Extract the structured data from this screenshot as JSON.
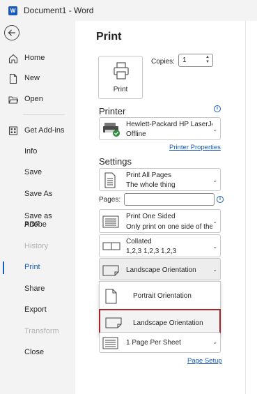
{
  "window": {
    "app_icon": "word-icon",
    "app_letter": "W",
    "title": "Document1  -  Word"
  },
  "nav": {
    "items": [
      {
        "label": "Home",
        "icon": "home-icon"
      },
      {
        "label": "New",
        "icon": "new-document-icon"
      },
      {
        "label": "Open",
        "icon": "open-folder-icon"
      },
      {
        "label": "Get Add-ins",
        "icon": "add-ins-icon"
      },
      {
        "label": "Info"
      },
      {
        "label": "Save"
      },
      {
        "label": "Save As"
      },
      {
        "label": "Save as Adobe PDF",
        "line1": "Save as Adobe",
        "line2": "PDF"
      },
      {
        "label": "History",
        "disabled": true
      },
      {
        "label": "Print",
        "active": true
      },
      {
        "label": "Share"
      },
      {
        "label": "Export"
      },
      {
        "label": "Transform",
        "disabled": true
      },
      {
        "label": "Close"
      }
    ]
  },
  "print": {
    "title": "Print",
    "button_label": "Print",
    "copies_label": "Copies:",
    "copies_value": "1"
  },
  "printer": {
    "heading": "Printer",
    "name": "Hewlett-Packard HP LaserJet...",
    "status": "Offline",
    "properties_link": "Printer Properties"
  },
  "settings": {
    "heading": "Settings",
    "pages_label": "Pages:",
    "pages_value": "",
    "print_range": {
      "line1": "Print All Pages",
      "line2": "The whole thing"
    },
    "sides": {
      "line1": "Print One Sided",
      "line2": "Only print on one side of the..."
    },
    "collation": {
      "line1": "Collated",
      "line2": "1,2,3   1,2,3   1,2,3"
    },
    "orientation": {
      "value": "Landscape Orientation"
    },
    "orientation_menu": [
      {
        "label": "Portrait Orientation"
      },
      {
        "label": "Landscape Orientation",
        "highlighted": true
      }
    ],
    "per_sheet": {
      "value": "1 Page Per Sheet"
    },
    "page_setup_link": "Page Setup"
  },
  "colors": {
    "accent": "#185abd",
    "highlight_border": "#a4262c",
    "sidebar_bg": "#f3f3f3"
  }
}
